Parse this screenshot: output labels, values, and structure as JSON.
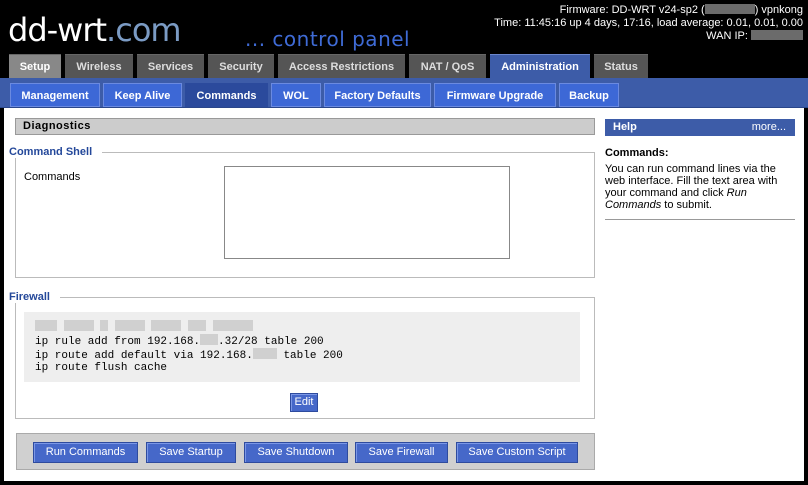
{
  "header": {
    "logo_main": "dd-wrt",
    "logo_domain": ".com",
    "tagline": "... control panel",
    "firmware_prefix": "Firmware: DD-WRT v24-sp2 (",
    "firmware_suffix": ") vpnkong",
    "time_line": "Time: 11:45:16 up 4 days, 17:16, load average: 0.01, 0.01, 0.00",
    "wan_ip_label": "WAN IP:"
  },
  "main_tabs": [
    "Setup",
    "Wireless",
    "Services",
    "Security",
    "Access Restrictions",
    "NAT / QoS",
    "Administration",
    "Status"
  ],
  "sub_tabs": [
    "Management",
    "Keep Alive",
    "Commands",
    "WOL",
    "Factory Defaults",
    "Firmware Upgrade",
    "Backup"
  ],
  "diagnostics": {
    "title": "Diagnostics",
    "command_shell_legend": "Command Shell",
    "commands_label": "Commands",
    "commands_value": ""
  },
  "firewall": {
    "legend": "Firewall",
    "line2": "ip rule add from 192.168.",
    "line2b": ".32/28 table 200",
    "line3": "ip route add default via 192.168.",
    "line3b": " table 200",
    "line4": "ip route flush cache",
    "edit_label": "Edit"
  },
  "buttons": {
    "run": "Run Commands",
    "startup": "Save Startup",
    "shutdown": "Save Shutdown",
    "firewall": "Save Firewall",
    "custom": "Save Custom Script"
  },
  "help": {
    "title": "Help",
    "more": "more...",
    "heading": "Commands:",
    "text_a": "You can run command lines via the web interface. Fill the text area with your command and click ",
    "text_em": "Run Commands",
    "text_b": " to submit."
  }
}
